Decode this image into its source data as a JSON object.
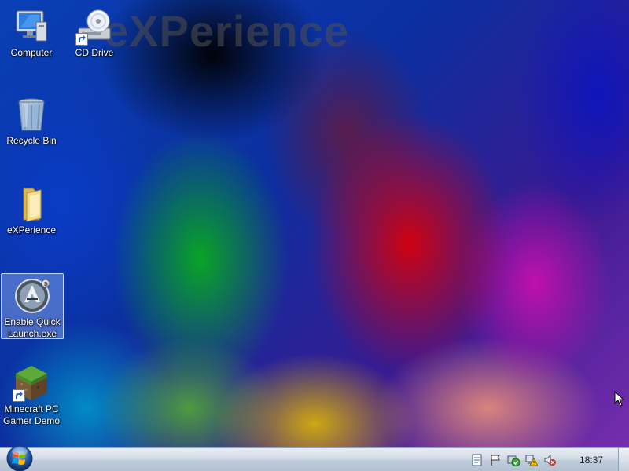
{
  "desktop": {
    "watermark": "eXPerience",
    "icons": [
      {
        "label": "Computer",
        "icon": "computer-icon"
      },
      {
        "label": "CD Drive",
        "icon": "cd-drive-icon"
      },
      {
        "label": "Recycle Bin",
        "icon": "recycle-bin-icon"
      },
      {
        "label": "eXPerience",
        "icon": "folder-icon"
      },
      {
        "label": "Enable Quick Launch.exe",
        "icon": "launcher-app-icon",
        "selected": true
      },
      {
        "label": "Minecraft PC Gamer Demo",
        "icon": "minecraft-grass-block-icon"
      }
    ]
  },
  "taskbar": {
    "start_button": "start-orb",
    "tray_icons": [
      "notification-icon",
      "action-center-flag-icon",
      "security-shield-icon",
      "network-warning-icon",
      "volume-muted-icon"
    ],
    "clock": "18:37"
  },
  "colors": {
    "taskbar_top": "#e8edf3",
    "taskbar_bottom": "#b3c1d2",
    "selection": "#bed7ff"
  }
}
